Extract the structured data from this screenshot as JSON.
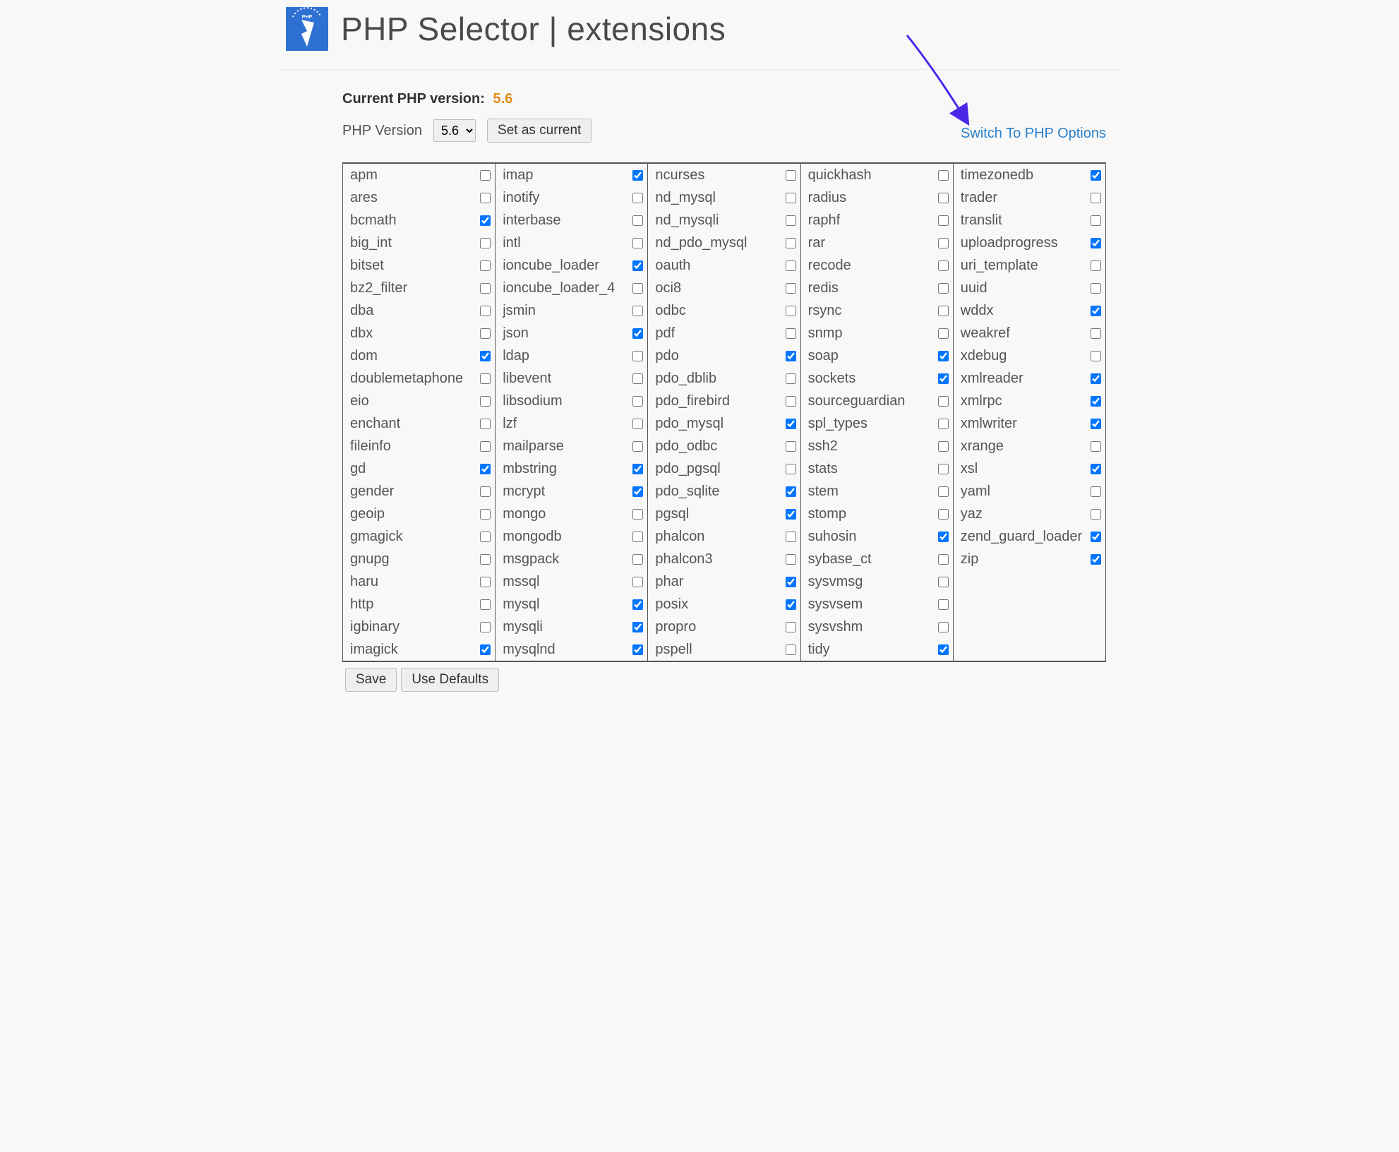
{
  "header": {
    "title": "PHP Selector | extensions"
  },
  "current": {
    "label": "Current PHP version:",
    "value": "5.6"
  },
  "version_row": {
    "label": "PHP Version",
    "selected": "5.6",
    "set_btn": "Set as current"
  },
  "switch_link": "Switch To PHP Options",
  "footer": {
    "save": "Save",
    "defaults": "Use Defaults"
  },
  "columns": [
    [
      {
        "n": "apm",
        "c": false
      },
      {
        "n": "ares",
        "c": false
      },
      {
        "n": "bcmath",
        "c": true
      },
      {
        "n": "big_int",
        "c": false
      },
      {
        "n": "bitset",
        "c": false
      },
      {
        "n": "bz2_filter",
        "c": false
      },
      {
        "n": "dba",
        "c": false
      },
      {
        "n": "dbx",
        "c": false
      },
      {
        "n": "dom",
        "c": true
      },
      {
        "n": "doublemetaphone",
        "c": false
      },
      {
        "n": "eio",
        "c": false
      },
      {
        "n": "enchant",
        "c": false
      },
      {
        "n": "fileinfo",
        "c": false
      },
      {
        "n": "gd",
        "c": true
      },
      {
        "n": "gender",
        "c": false
      },
      {
        "n": "geoip",
        "c": false
      },
      {
        "n": "gmagick",
        "c": false
      },
      {
        "n": "gnupg",
        "c": false
      },
      {
        "n": "haru",
        "c": false
      },
      {
        "n": "http",
        "c": false
      },
      {
        "n": "igbinary",
        "c": false
      },
      {
        "n": "imagick",
        "c": true
      }
    ],
    [
      {
        "n": "imap",
        "c": true
      },
      {
        "n": "inotify",
        "c": false
      },
      {
        "n": "interbase",
        "c": false
      },
      {
        "n": "intl",
        "c": false
      },
      {
        "n": "ioncube_loader",
        "c": true
      },
      {
        "n": "ioncube_loader_4",
        "c": false
      },
      {
        "n": "jsmin",
        "c": false
      },
      {
        "n": "json",
        "c": true
      },
      {
        "n": "ldap",
        "c": false
      },
      {
        "n": "libevent",
        "c": false
      },
      {
        "n": "libsodium",
        "c": false
      },
      {
        "n": "lzf",
        "c": false
      },
      {
        "n": "mailparse",
        "c": false
      },
      {
        "n": "mbstring",
        "c": true
      },
      {
        "n": "mcrypt",
        "c": true
      },
      {
        "n": "mongo",
        "c": false
      },
      {
        "n": "mongodb",
        "c": false
      },
      {
        "n": "msgpack",
        "c": false
      },
      {
        "n": "mssql",
        "c": false
      },
      {
        "n": "mysql",
        "c": true
      },
      {
        "n": "mysqli",
        "c": true
      },
      {
        "n": "mysqlnd",
        "c": true
      }
    ],
    [
      {
        "n": "ncurses",
        "c": false
      },
      {
        "n": "nd_mysql",
        "c": false
      },
      {
        "n": "nd_mysqli",
        "c": false
      },
      {
        "n": "nd_pdo_mysql",
        "c": false
      },
      {
        "n": "oauth",
        "c": false
      },
      {
        "n": "oci8",
        "c": false
      },
      {
        "n": "odbc",
        "c": false
      },
      {
        "n": "pdf",
        "c": false
      },
      {
        "n": "pdo",
        "c": true
      },
      {
        "n": "pdo_dblib",
        "c": false
      },
      {
        "n": "pdo_firebird",
        "c": false
      },
      {
        "n": "pdo_mysql",
        "c": true
      },
      {
        "n": "pdo_odbc",
        "c": false
      },
      {
        "n": "pdo_pgsql",
        "c": false
      },
      {
        "n": "pdo_sqlite",
        "c": true
      },
      {
        "n": "pgsql",
        "c": true
      },
      {
        "n": "phalcon",
        "c": false
      },
      {
        "n": "phalcon3",
        "c": false
      },
      {
        "n": "phar",
        "c": true
      },
      {
        "n": "posix",
        "c": true
      },
      {
        "n": "propro",
        "c": false
      },
      {
        "n": "pspell",
        "c": false
      }
    ],
    [
      {
        "n": "quickhash",
        "c": false
      },
      {
        "n": "radius",
        "c": false
      },
      {
        "n": "raphf",
        "c": false
      },
      {
        "n": "rar",
        "c": false
      },
      {
        "n": "recode",
        "c": false
      },
      {
        "n": "redis",
        "c": false
      },
      {
        "n": "rsync",
        "c": false
      },
      {
        "n": "snmp",
        "c": false
      },
      {
        "n": "soap",
        "c": true
      },
      {
        "n": "sockets",
        "c": true
      },
      {
        "n": "sourceguardian",
        "c": false
      },
      {
        "n": "spl_types",
        "c": false
      },
      {
        "n": "ssh2",
        "c": false
      },
      {
        "n": "stats",
        "c": false
      },
      {
        "n": "stem",
        "c": false
      },
      {
        "n": "stomp",
        "c": false
      },
      {
        "n": "suhosin",
        "c": true
      },
      {
        "n": "sybase_ct",
        "c": false
      },
      {
        "n": "sysvmsg",
        "c": false
      },
      {
        "n": "sysvsem",
        "c": false
      },
      {
        "n": "sysvshm",
        "c": false
      },
      {
        "n": "tidy",
        "c": true
      }
    ],
    [
      {
        "n": "timezonedb",
        "c": true
      },
      {
        "n": "trader",
        "c": false
      },
      {
        "n": "translit",
        "c": false
      },
      {
        "n": "uploadprogress",
        "c": true
      },
      {
        "n": "uri_template",
        "c": false
      },
      {
        "n": "uuid",
        "c": false
      },
      {
        "n": "wddx",
        "c": true
      },
      {
        "n": "weakref",
        "c": false
      },
      {
        "n": "xdebug",
        "c": false
      },
      {
        "n": "xmlreader",
        "c": true
      },
      {
        "n": "xmlrpc",
        "c": true
      },
      {
        "n": "xmlwriter",
        "c": true
      },
      {
        "n": "xrange",
        "c": false
      },
      {
        "n": "xsl",
        "c": true
      },
      {
        "n": "yaml",
        "c": false
      },
      {
        "n": "yaz",
        "c": false
      },
      {
        "n": "zend_guard_loader",
        "c": true
      },
      {
        "n": "zip",
        "c": true
      }
    ]
  ]
}
